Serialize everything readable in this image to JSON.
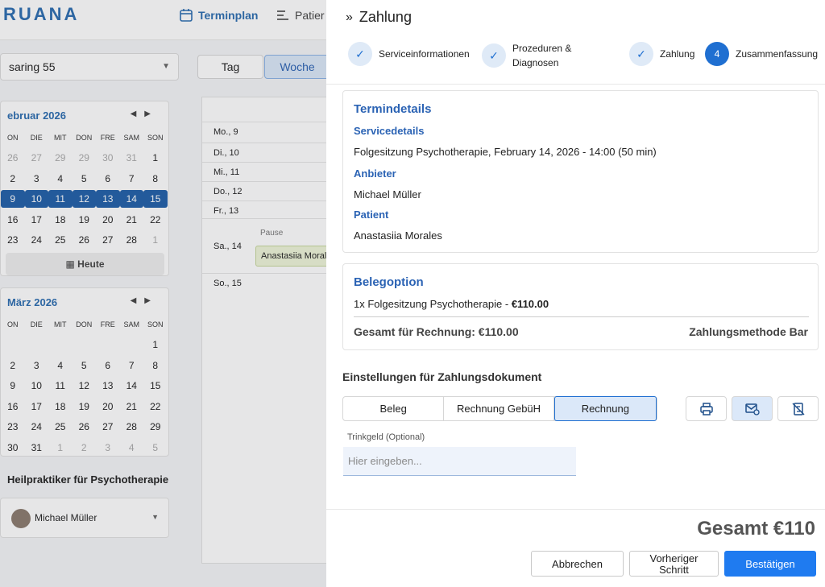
{
  "app": {
    "logo": "RUANA",
    "nav_termin": "Terminplan",
    "nav_patient": "Patier"
  },
  "left": {
    "location": "saring 55",
    "feb": {
      "title": "ebruar 2026",
      "days": [
        "ON",
        "DIE",
        "MIT",
        "DON",
        "FRE",
        "SAM",
        "SON"
      ],
      "weeks": [
        [
          "26",
          "27",
          "29",
          "29",
          "30",
          "31",
          "1"
        ],
        [
          "2",
          "3",
          "4",
          "5",
          "6",
          "7",
          "8"
        ],
        [
          "9",
          "10",
          "11",
          "12",
          "13",
          "14",
          "15"
        ],
        [
          "16",
          "17",
          "18",
          "19",
          "20",
          "21",
          "22"
        ],
        [
          "23",
          "24",
          "25",
          "26",
          "27",
          "28",
          "1"
        ]
      ]
    },
    "today": "Heute",
    "mar": {
      "title": "März 2026",
      "days": [
        "ON",
        "DIE",
        "MIT",
        "DON",
        "FRE",
        "SAM",
        "SON"
      ],
      "weeks": [
        [
          "",
          "",
          "",
          "",
          "",
          "",
          "1"
        ],
        [
          "2",
          "3",
          "4",
          "5",
          "6",
          "7",
          "8"
        ],
        [
          "9",
          "10",
          "11",
          "12",
          "13",
          "14",
          "15"
        ],
        [
          "16",
          "17",
          "18",
          "19",
          "20",
          "21",
          "22"
        ],
        [
          "23",
          "24",
          "25",
          "26",
          "27",
          "28",
          "29"
        ],
        [
          "30",
          "31",
          "1",
          "2",
          "3",
          "4",
          "5"
        ]
      ]
    },
    "practitioner_heading": "Heilpraktiker für Psychotherapie",
    "practitioner": "Michael Müller"
  },
  "calendar": {
    "tab_day": "Tag",
    "tab_week": "Woche",
    "rows": [
      "Mo., 9",
      "Di., 10",
      "Mi., 11",
      "Do., 12",
      "Fr., 13",
      "Sa., 14",
      "So., 15"
    ],
    "pause": "Pause",
    "event": "Anastasiia Moral"
  },
  "panel": {
    "title": "Zahlung",
    "steps": [
      {
        "label": "Serviceinformationen"
      },
      {
        "label": "Prozeduren &",
        "label2": "Diagnosen"
      },
      {
        "label": "Zahlung"
      },
      {
        "label": "Zusammenfassung",
        "num": "4"
      }
    ],
    "termin": {
      "heading": "Termindetails",
      "service_h": "Servicedetails",
      "service": "Folgesitzung Psychotherapie, February 14, 2026 - 14:00 (50 min)",
      "anbieter_h": "Anbieter",
      "anbieter": "Michael Müller",
      "patient_h": "Patient",
      "patient": "Anastasiia Morales"
    },
    "beleg": {
      "heading": "Belegoption",
      "item": "1x Folgesitzung Psychotherapie - ",
      "price": "€110.00",
      "total_label": "Gesamt für Rechnung: €110.00",
      "method": "Zahlungsmethode Bar"
    },
    "settings_heading": "Einstellungen für Zahlungsdokument",
    "doc_options": [
      "Beleg",
      "Rechnung GebüH",
      "Rechnung"
    ],
    "tip_label": "Trinkgeld (Optional)",
    "tip_placeholder": "Hier eingeben...",
    "total": "Gesamt €110",
    "cancel": "Abbrechen",
    "prev1": "Vorheriger",
    "prev2": "Schritt",
    "confirm": "Bestätigen",
    "colors": {
      "accent": "#1f7bf0",
      "heading": "#2b63b4"
    }
  }
}
